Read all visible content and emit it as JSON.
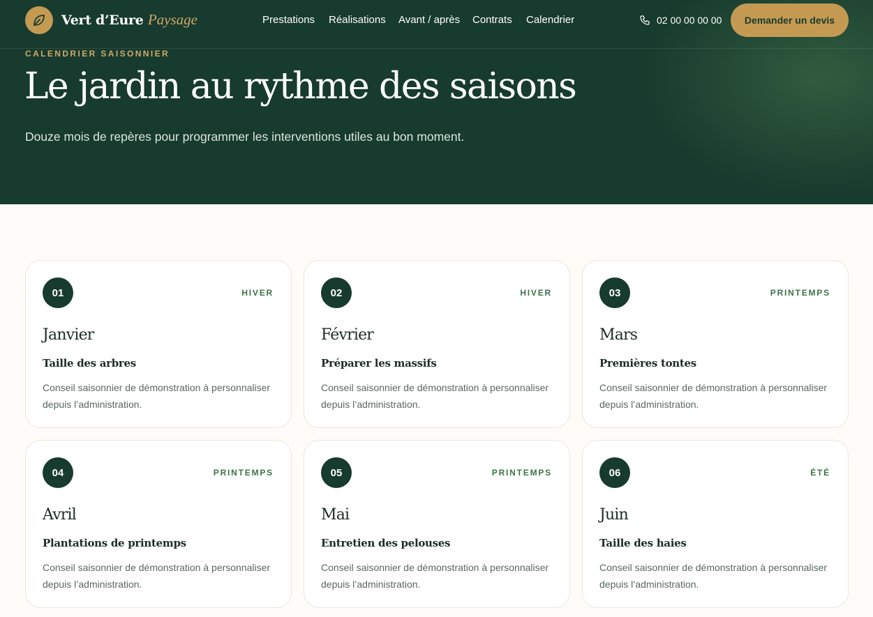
{
  "header": {
    "logo_icon": "leaf-icon",
    "brand_name": "Vert d’Eure",
    "brand_accent": "Paysage",
    "nav": [
      {
        "label": "Prestations"
      },
      {
        "label": "Réalisations"
      },
      {
        "label": "Avant / après"
      },
      {
        "label": "Contrats"
      },
      {
        "label": "Calendrier"
      }
    ],
    "phone_icon": "phone-icon",
    "phone": "02 00 00 00 00",
    "cta_label": "Demander un devis"
  },
  "hero": {
    "eyebrow": "CALENDRIER SAISONNIER",
    "title": "Le jardin au rythme des saisons",
    "subtitle": "Douze mois de repères pour programmer les interventions utiles au bon moment."
  },
  "months": [
    {
      "number": "01",
      "season": "HIVER",
      "month": "Janvier",
      "task": "Taille des arbres",
      "description": "Conseil saisonnier de démonstration à personnaliser depuis l’administration."
    },
    {
      "number": "02",
      "season": "HIVER",
      "month": "Février",
      "task": "Préparer les massifs",
      "description": "Conseil saisonnier de démonstration à personnaliser depuis l’administration."
    },
    {
      "number": "03",
      "season": "PRINTEMPS",
      "month": "Mars",
      "task": "Premières tontes",
      "description": "Conseil saisonnier de démonstration à personnaliser depuis l’administration."
    },
    {
      "number": "04",
      "season": "PRINTEMPS",
      "month": "Avril",
      "task": "Plantations de printemps",
      "description": "Conseil saisonnier de démonstration à personnaliser depuis l’administration."
    },
    {
      "number": "05",
      "season": "PRINTEMPS",
      "month": "Mai",
      "task": "Entretien des pelouses",
      "description": "Conseil saisonnier de démonstration à personnaliser depuis l’administration."
    },
    {
      "number": "06",
      "season": "ÉTÉ",
      "month": "Juin",
      "task": "Taille des haies",
      "description": "Conseil saisonnier de démonstration à personnaliser depuis l’administration."
    }
  ],
  "colors": {
    "primary": "#173b2e",
    "accent": "#c49a52",
    "season_label": "#3b7349",
    "background": "#fdfcf8"
  }
}
